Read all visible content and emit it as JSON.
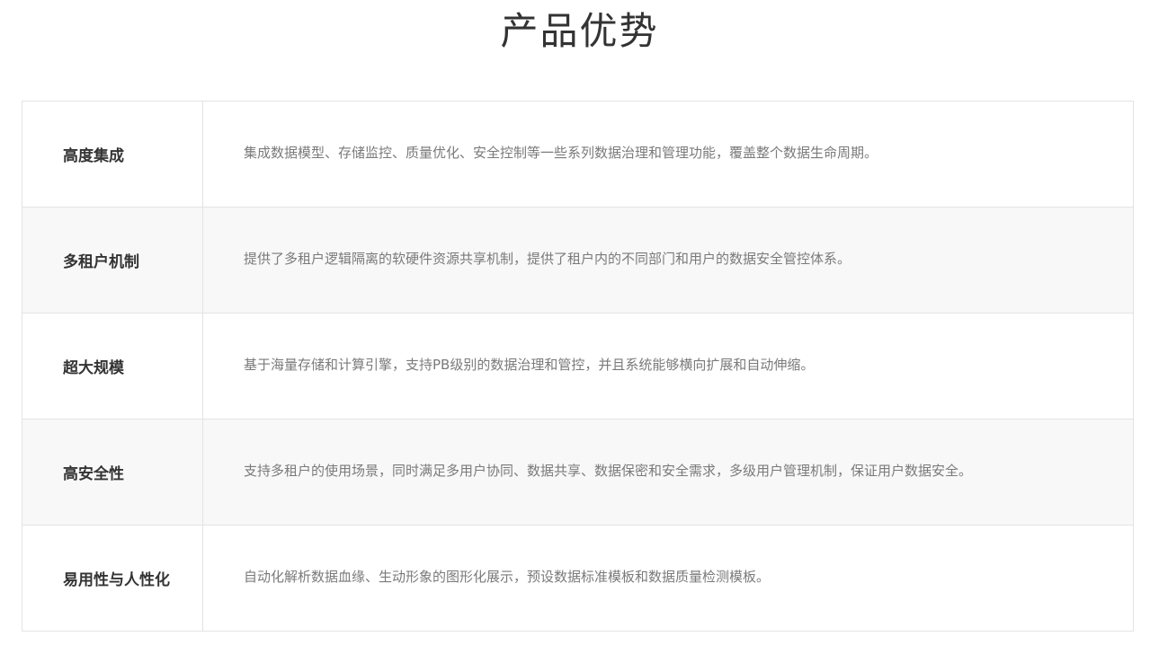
{
  "title": "产品优势",
  "rows": [
    {
      "title": "高度集成",
      "description": "集成数据模型、存储监控、质量优化、安全控制等一些系列数据治理和管理功能，覆盖整个数据生命周期。"
    },
    {
      "title": "多租户机制",
      "description": "提供了多租户逻辑隔离的软硬件资源共享机制，提供了租户内的不同部门和用户的数据安全管控体系。"
    },
    {
      "title": "超大规模",
      "description": "基于海量存储和计算引擎，支持PB级别的数据治理和管控，并且系统能够横向扩展和自动伸缩。"
    },
    {
      "title": "高安全性",
      "description": "支持多租户的使用场景，同时满足多用户协同、数据共享、数据保密和安全需求，多级用户管理机制，保证用户数据安全。"
    },
    {
      "title": "易用性与人性化",
      "description": "自动化解析数据血缘、生动形象的图形化展示，预设数据标准模板和数据质量检测模板。"
    }
  ]
}
